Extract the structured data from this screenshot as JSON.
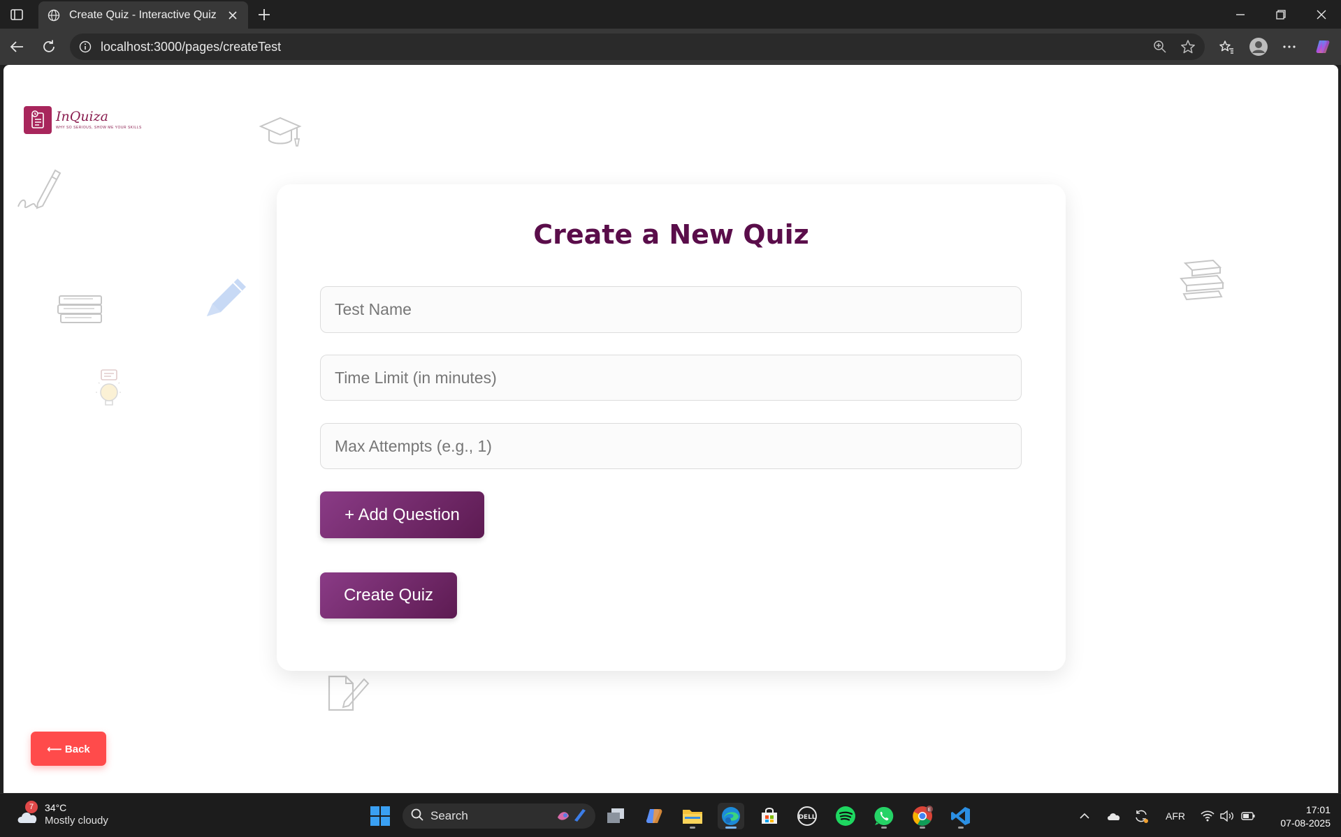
{
  "browser": {
    "tab_title": "Create Quiz - Interactive Quiz",
    "url": "localhost:3000/pages/createTest"
  },
  "page": {
    "logo": {
      "name": "InQuiza",
      "tagline": "WHY SO SERIOUS, SHOW ME YOUR SKILLS"
    },
    "heading": "Create a New Quiz",
    "fields": {
      "test_name_placeholder": "Test Name",
      "time_limit_placeholder": "Time Limit (in minutes)",
      "max_attempts_placeholder": "Max Attempts (e.g., 1)"
    },
    "add_question_label": "+ Add Question",
    "create_quiz_label": "Create Quiz",
    "back_label": "⟵ Back"
  },
  "taskbar": {
    "weather": {
      "temp": "34°C",
      "desc": "Mostly cloudy",
      "badge": "7"
    },
    "search_label": "Search",
    "language": "AFR",
    "time": "17:01",
    "date": "07-08-2025"
  },
  "colors": {
    "heading": "#5a0d4a",
    "button_gradient_start": "#8a3b86",
    "button_gradient_end": "#5d1b52",
    "back_button": "#ff4b4b"
  }
}
